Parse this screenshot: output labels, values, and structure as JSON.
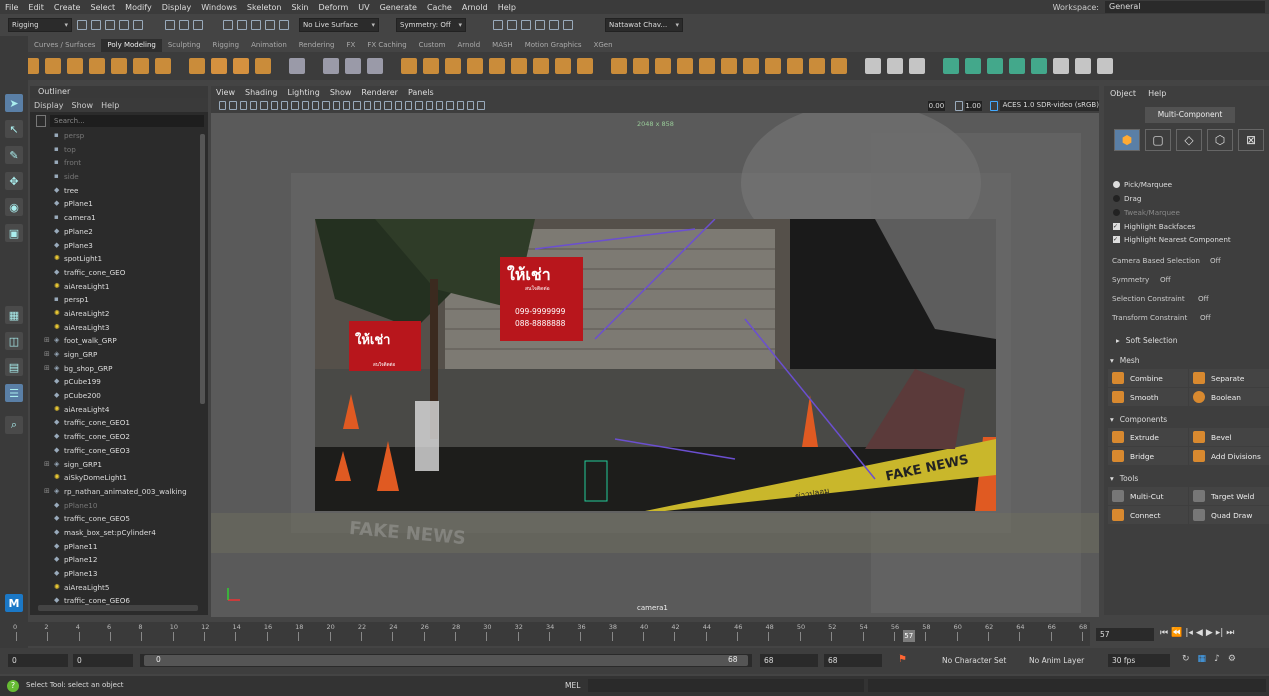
{
  "menu": [
    "File",
    "Edit",
    "Create",
    "Select",
    "Modify",
    "Display",
    "Windows",
    "Skeleton",
    "Skin",
    "Deform",
    "UV",
    "Generate",
    "Cache",
    "Arnold",
    "Help"
  ],
  "workspace": {
    "label": "Workspace:",
    "value": "General"
  },
  "status": {
    "mode": "Rigging",
    "live": "No Live Surface",
    "symmetry": "Symmetry: Off",
    "user": "Nattawat Chav..."
  },
  "shelf_tabs": [
    "Curves / Surfaces",
    "Poly Modeling",
    "Sculpting",
    "Rigging",
    "Animation",
    "Rendering",
    "FX",
    "FX Caching",
    "Custom",
    "Arnold",
    "MASH",
    "Motion Graphics",
    "XGen"
  ],
  "shelf_active": "Poly Modeling",
  "outliner": {
    "title": "Outliner",
    "menu": [
      "Display",
      "Show",
      "Help"
    ],
    "search": "Search...",
    "items": [
      {
        "n": "persp",
        "i": "cam",
        "d": true
      },
      {
        "n": "top",
        "i": "cam",
        "d": true
      },
      {
        "n": "front",
        "i": "cam",
        "d": true
      },
      {
        "n": "side",
        "i": "cam",
        "d": true
      },
      {
        "n": "tree",
        "i": "mesh"
      },
      {
        "n": "pPlane1",
        "i": "mesh"
      },
      {
        "n": "camera1",
        "i": "cam"
      },
      {
        "n": "pPlane2",
        "i": "mesh"
      },
      {
        "n": "pPlane3",
        "i": "mesh"
      },
      {
        "n": "spotLight1",
        "i": "light"
      },
      {
        "n": "traffic_cone_GEO",
        "i": "mesh"
      },
      {
        "n": "aiAreaLight1",
        "i": "light"
      },
      {
        "n": "persp1",
        "i": "cam"
      },
      {
        "n": "aiAreaLight2",
        "i": "light"
      },
      {
        "n": "aiAreaLight3",
        "i": "light"
      },
      {
        "n": "foot_walk_GRP",
        "i": "grp",
        "e": true
      },
      {
        "n": "sign_GRP",
        "i": "grp",
        "e": true
      },
      {
        "n": "bg_shop_GRP",
        "i": "grp",
        "e": true
      },
      {
        "n": "pCube199",
        "i": "mesh"
      },
      {
        "n": "pCube200",
        "i": "mesh"
      },
      {
        "n": "aiAreaLight4",
        "i": "light"
      },
      {
        "n": "traffic_cone_GEO1",
        "i": "mesh"
      },
      {
        "n": "traffic_cone_GEO2",
        "i": "mesh"
      },
      {
        "n": "traffic_cone_GEO3",
        "i": "mesh"
      },
      {
        "n": "sign_GRP1",
        "i": "grp",
        "e": true
      },
      {
        "n": "aiSkyDomeLight1",
        "i": "light"
      },
      {
        "n": "rp_nathan_animated_003_walking",
        "i": "grp",
        "e": true
      },
      {
        "n": "pPlane10",
        "i": "mesh",
        "d": true
      },
      {
        "n": "traffic_cone_GEO5",
        "i": "mesh"
      },
      {
        "n": "mask_box_set:pCylinder4",
        "i": "mesh"
      },
      {
        "n": "pPlane11",
        "i": "mesh"
      },
      {
        "n": "pPlane12",
        "i": "mesh"
      },
      {
        "n": "pPlane13",
        "i": "mesh"
      },
      {
        "n": "aiAreaLight5",
        "i": "light"
      },
      {
        "n": "traffic_cone_GEO6",
        "i": "mesh"
      }
    ]
  },
  "viewport": {
    "menu": [
      "View",
      "Shading",
      "Lighting",
      "Show",
      "Renderer",
      "Panels"
    ],
    "near": "0.00",
    "far": "1.00",
    "colorspace": "ACES 1.0 SDR-video (sRGB)",
    "resolution": "2048 x 858",
    "camera": "camera1",
    "sign_big": "ให้เช่า",
    "sign_big_sub": "สนใจติดต่อ",
    "phone1": "099-9999999",
    "phone2": "088-8888888",
    "sign_small": "ให้เช่า",
    "sign_small_sub": "สนใจติดต่อ",
    "tape": "FAKE NEWS",
    "tape2": "ข่าวปลอม",
    "tape3": "FAKE NEWS"
  },
  "right": {
    "menu": [
      "Object",
      "Help"
    ],
    "header": "Multi-Component",
    "options": [
      "Pick/Marquee",
      "Drag",
      "Tweak/Marquee",
      "Highlight Backfaces",
      "Highlight Nearest Component"
    ],
    "cam_sel": "Camera Based Selection",
    "cam_val": "Off",
    "sym": "Symmetry",
    "sym_val": "Off",
    "sc": "Selection Constraint",
    "sc_val": "Off",
    "tc": "Transform Constraint",
    "tc_val": "Off",
    "soft": "Soft Selection",
    "mesh": "Mesh",
    "combine": "Combine",
    "separate": "Separate",
    "smooth": "Smooth",
    "boolean": "Boolean",
    "components": "Components",
    "extrude": "Extrude",
    "bevel": "Bevel",
    "bridge": "Bridge",
    "add_div": "Add Divisions",
    "tools": "Tools",
    "multicut": "Multi-Cut",
    "targetweld": "Target Weld",
    "connect": "Connect",
    "quaddraw": "Quad Draw"
  },
  "timeline": {
    "ticks": [
      "0",
      "2",
      "4",
      "6",
      "8",
      "10",
      "12",
      "14",
      "16",
      "18",
      "20",
      "22",
      "24",
      "26",
      "28",
      "30",
      "32",
      "34",
      "36",
      "38",
      "40",
      "42",
      "44",
      "46",
      "48",
      "50",
      "52",
      "54",
      "56",
      "58",
      "60",
      "62",
      "64",
      "66",
      "68"
    ],
    "current": "57",
    "current_field": "57",
    "current_frac": 0.838
  },
  "range": {
    "start": "0",
    "start2": "0",
    "slider_start": "0",
    "slider_end": "68",
    "end": "68",
    "end2": "68",
    "char": "No Character Set",
    "anim": "No Anim Layer",
    "fps": "30 fps"
  },
  "statusbar": {
    "msg": "Select Tool: select an object",
    "mel": "MEL"
  }
}
